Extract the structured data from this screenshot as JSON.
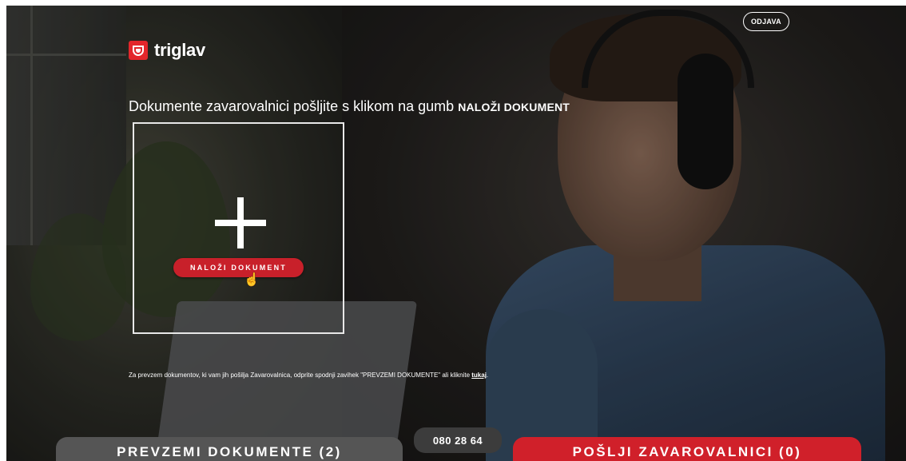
{
  "brand": {
    "name": "triglav",
    "logo_icon": "triglav-logo-icon",
    "accent": "#e3262b"
  },
  "header": {
    "logout_label": "ODJAVA"
  },
  "instruction": {
    "text": "Dokumente zavarovalnici pošljite s klikom na gumb ",
    "button_ref": "NALOŽI DOKUMENT"
  },
  "upload": {
    "icon": "plus-icon",
    "button_label": "NALOŽI DOKUMENT"
  },
  "note": {
    "text": "Za prevzem dokumentov, ki vam jih pošilja Zavarovalnica, odprite spodnji zavihek \"PREVZEMI DOKUMENTE\" ali kliknite ",
    "link_label": "tukaj",
    "suffix": "."
  },
  "footer": {
    "phone": "080 28 64",
    "tab_download_label": "PREVZEMI DOKUMENTE (2)",
    "tab_send_label": "POŠLJI ZAVAROVALNICI (0)"
  },
  "colors": {
    "send_tab": "#d0202a",
    "download_tab": "#555555"
  }
}
